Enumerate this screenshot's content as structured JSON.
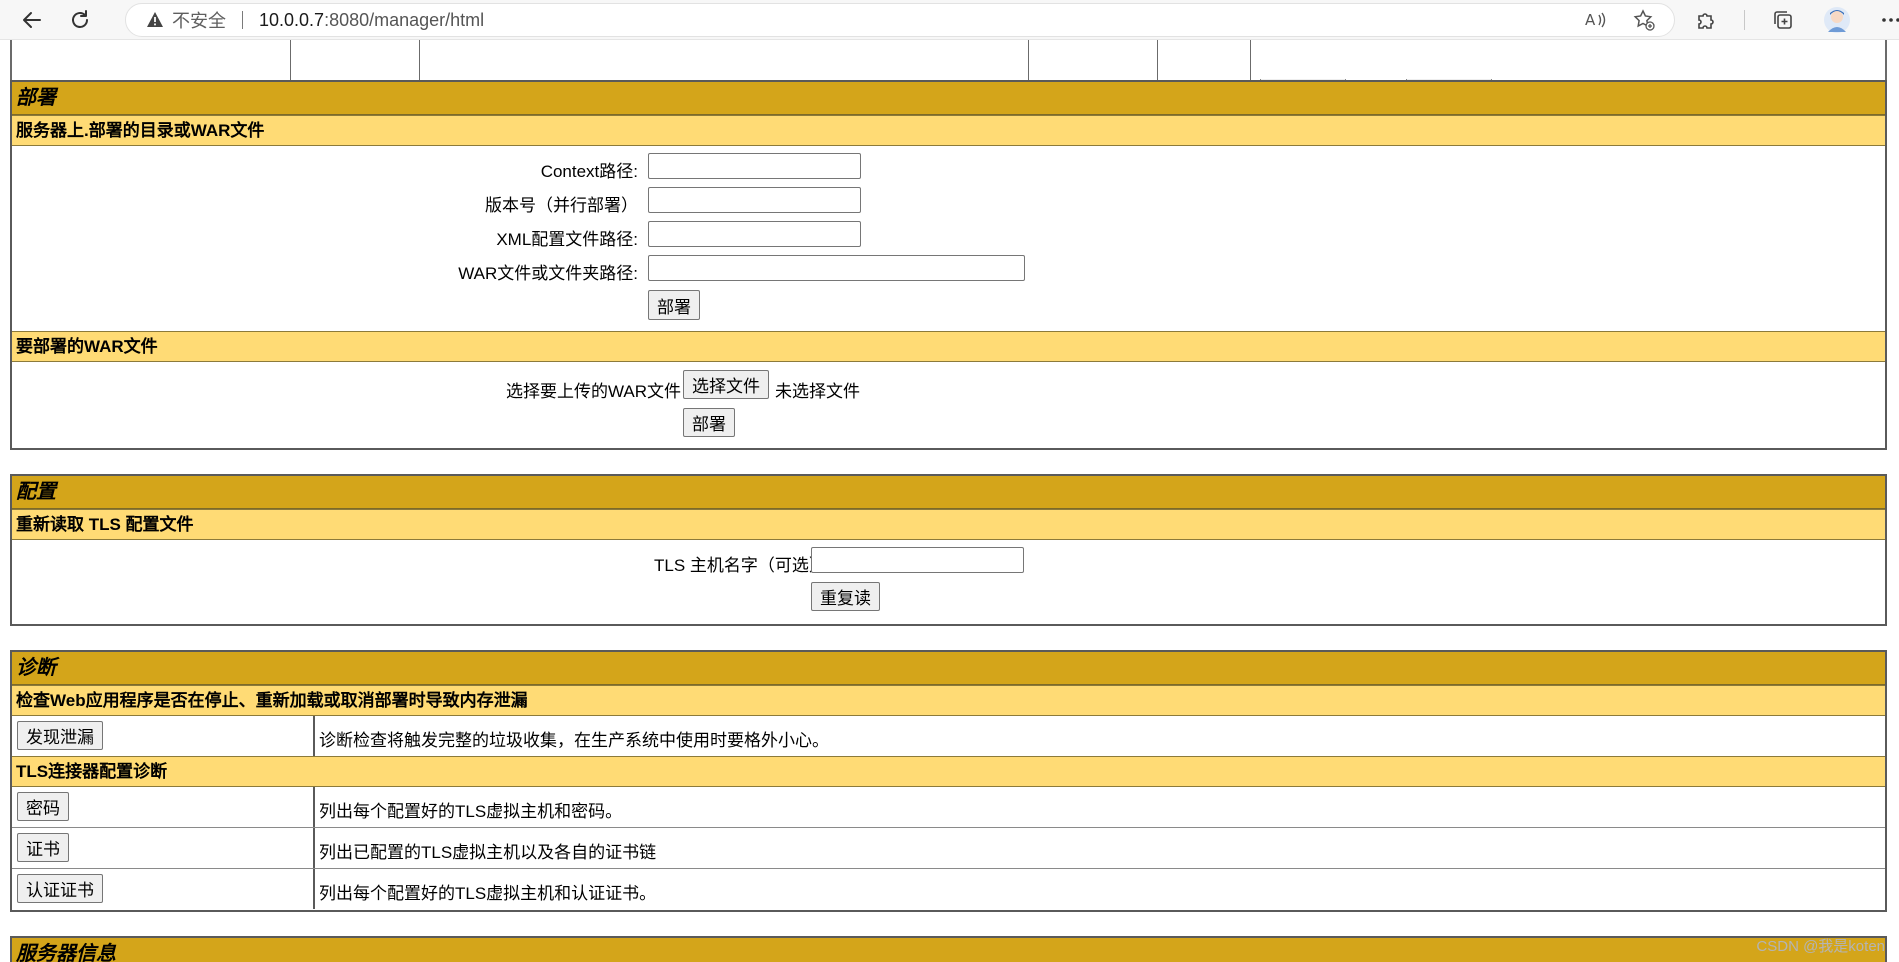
{
  "browser": {
    "security_label": "不安全",
    "url_host": "10.0.0.7",
    "url_rest": ":8080/manager/html"
  },
  "deploy": {
    "title": "部署",
    "server_subtitle": "服务器上.部署的目录或WAR文件",
    "context_label": "Context路径:",
    "context_value": "",
    "version_label": "版本号（并行部署）",
    "version_value": "",
    "xml_label": "XML配置文件路径:",
    "xml_value": "",
    "war_label": "WAR文件或文件夹路径:",
    "war_value": "",
    "deploy_button": "部署",
    "upload_subtitle": "要部署的WAR文件",
    "upload_label": "选择要上传的WAR文件",
    "choose_button": "选择文件",
    "no_file": "未选择文件",
    "upload_deploy_button": "部署"
  },
  "config": {
    "title": "配置",
    "subtitle": "重新读取 TLS 配置文件",
    "tls_label": "TLS 主机名字（可选）",
    "tls_value": "",
    "reload_button": "重复读"
  },
  "diagnostics": {
    "title": "诊断",
    "leak_subtitle": "检查Web应用程序是否在停止、重新加载或取消部署时导致内存泄漏",
    "leak_button": "发现泄漏",
    "leak_desc": "诊断检查将触发完整的垃圾收集，在生产系统中使用时要格外小心。",
    "tls_subtitle": "TLS连接器配置诊断",
    "rows": [
      {
        "button": "密码",
        "desc": "列出每个配置好的TLS虚拟主机和密码。"
      },
      {
        "button": "证书",
        "desc": "列出已配置的TLS虚拟主机以及各自的证书链"
      },
      {
        "button": "认证证书",
        "desc": "列出每个配置好的TLS虚拟主机和认证证书。"
      }
    ]
  },
  "server_info": {
    "title": "服务器信息"
  },
  "watermark": "CSDN @我是koten"
}
